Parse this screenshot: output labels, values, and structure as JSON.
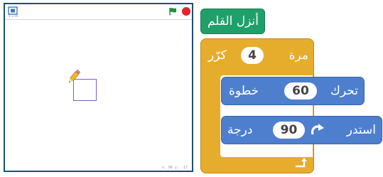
{
  "stage": {
    "version_label": "v.106",
    "coord_readout": "x: 96  y: -17",
    "icons": {
      "fullscreen": "fullscreen-icon",
      "green_flag": "green-flag-icon",
      "stop": "stop-icon",
      "pencil": "pencil-sprite-icon"
    },
    "colors": {
      "flag": "#1f8f3a",
      "stop": "#e8232b",
      "pen_line": "#7b5fc4"
    }
  },
  "script": {
    "pen_down": {
      "label": "أنزل القلم",
      "color": "#1fa06b"
    },
    "repeat": {
      "label_pre": "كرّر",
      "count": "4",
      "label_post": "مرة",
      "color": "#e6ac2c"
    },
    "move": {
      "label_pre": "تحرك",
      "steps": "60",
      "label_post": "خطوة",
      "color": "#4e7fce"
    },
    "turn": {
      "label_pre": "استدر",
      "degrees": "90",
      "label_post": "درجة",
      "icon": "rotate-clockwise-icon"
    },
    "loop_end_icon": "loop-arrow-icon"
  }
}
